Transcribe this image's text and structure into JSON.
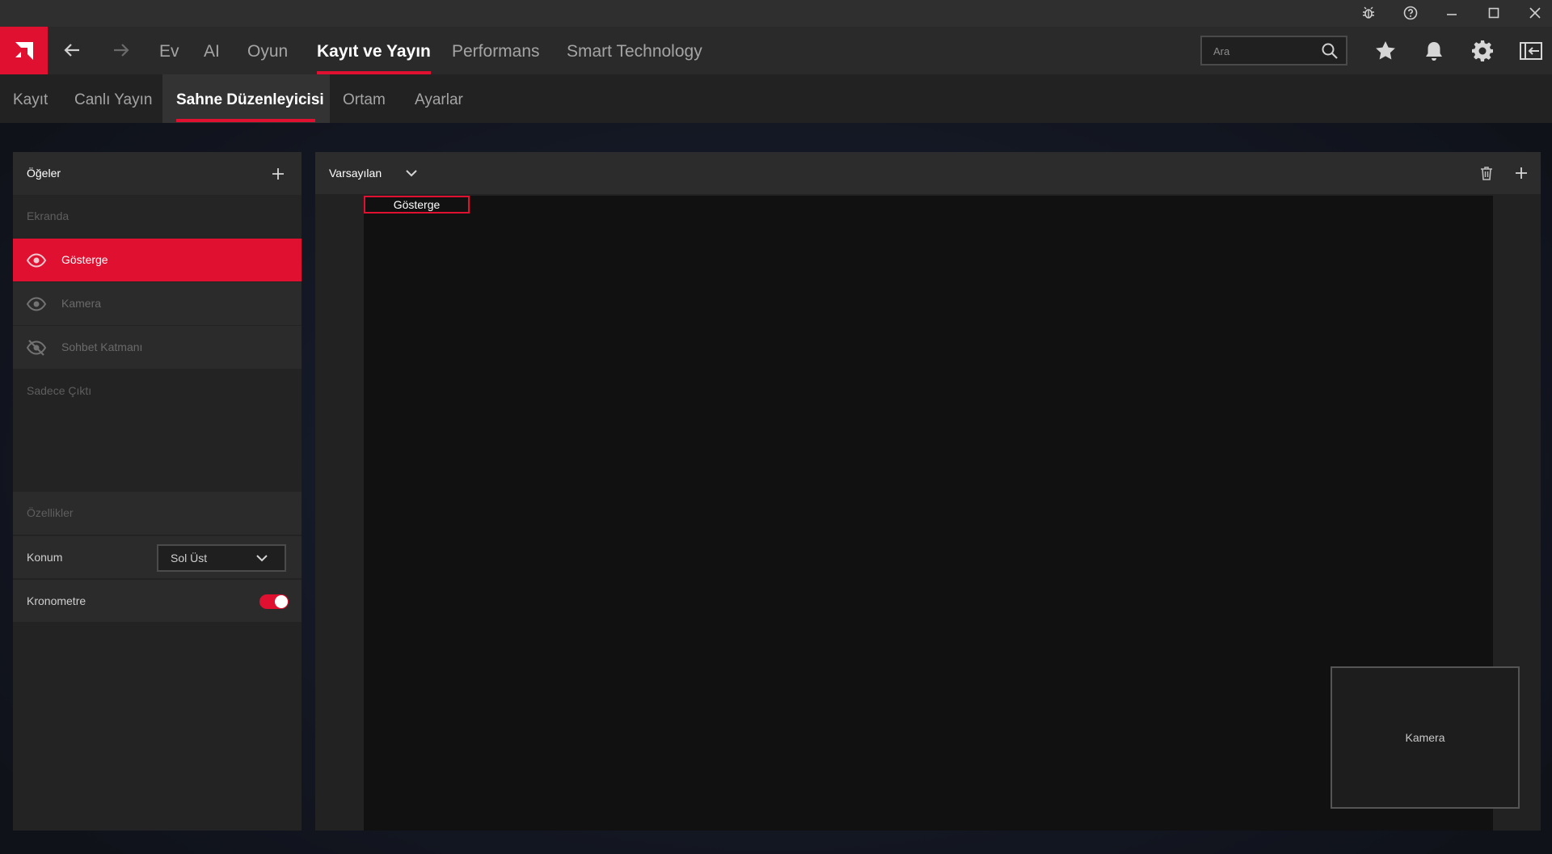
{
  "window_controls": {
    "bug_icon": "bug-icon",
    "help_icon": "help-icon",
    "minimize_icon": "minimize-icon",
    "maximize_icon": "maximize-icon",
    "close_icon": "close-icon"
  },
  "top_nav": {
    "tabs": [
      {
        "label": "Ev"
      },
      {
        "label": "AI"
      },
      {
        "label": "Oyun"
      },
      {
        "label": "Kayıt ve Yayın",
        "active": true
      },
      {
        "label": "Performans"
      },
      {
        "label": "Smart Technology"
      }
    ],
    "search": {
      "placeholder": "Ara",
      "value": ""
    },
    "icons": [
      "star-icon",
      "bell-icon",
      "gear-icon",
      "sidebar-toggle-icon"
    ]
  },
  "sub_nav": {
    "tabs": [
      {
        "label": "Kayıt"
      },
      {
        "label": "Canlı Yayın"
      },
      {
        "label": "Sahne Düzenleyicisi",
        "active": true
      },
      {
        "label": "Ortam"
      },
      {
        "label": "Ayarlar"
      }
    ]
  },
  "items_panel": {
    "title": "Öğeler",
    "section_on_screen": "Ekranda",
    "items": [
      {
        "label": "Gösterge",
        "selected": true,
        "visibility": "visible"
      },
      {
        "label": "Kamera",
        "selected": false,
        "visibility": "visible"
      },
      {
        "label": "Sohbet Katmanı",
        "selected": false,
        "visibility": "hidden"
      }
    ],
    "section_output_only": "Sadece Çıktı"
  },
  "properties": {
    "title": "Özellikler",
    "position_label": "Konum",
    "position_value": "Sol Üst",
    "stopwatch_label": "Kronometre",
    "stopwatch_enabled": true
  },
  "scene": {
    "preset": "Varsayılan",
    "overlay_label": "Gösterge",
    "camera_label": "Kamera"
  },
  "colors": {
    "accent": "#e01030",
    "background": "#222222",
    "header": "#2a2a2a"
  }
}
